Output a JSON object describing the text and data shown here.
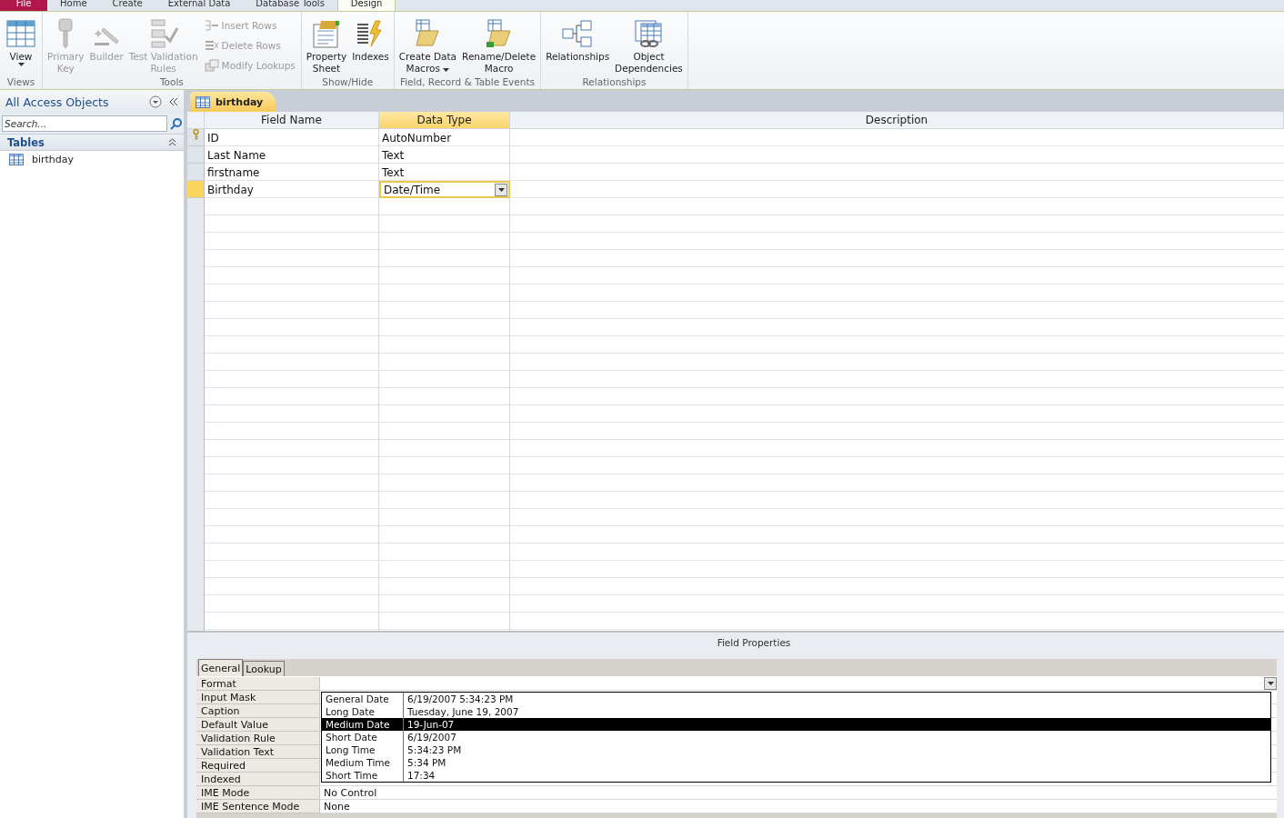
{
  "ribbon_tabs": [
    {
      "label": "File",
      "kind": "file",
      "selected": false
    },
    {
      "label": "Home",
      "kind": "tab",
      "selected": false
    },
    {
      "label": "Create",
      "kind": "tab",
      "selected": false
    },
    {
      "label": "External Data",
      "kind": "tab",
      "selected": false
    },
    {
      "label": "Database Tools",
      "kind": "tab",
      "selected": false
    },
    {
      "label": "Design",
      "kind": "tab",
      "selected": true
    }
  ],
  "ribbon_groups": [
    {
      "label": "Views",
      "items": [
        {
          "kind": "large",
          "lines": [
            "View"
          ],
          "dropdown": true,
          "disabled": false
        }
      ]
    },
    {
      "label": "Tools",
      "items": [
        {
          "kind": "large",
          "lines": [
            "Primary",
            "Key"
          ],
          "dropdown": false,
          "disabled": true
        },
        {
          "kind": "large",
          "lines": [
            "Builder"
          ],
          "dropdown": false,
          "disabled": true
        },
        {
          "kind": "large",
          "lines": [
            "Test Validation",
            "Rules"
          ],
          "dropdown": false,
          "disabled": true
        },
        {
          "kind": "stack",
          "buttons": [
            {
              "label": "Insert Rows",
              "disabled": true
            },
            {
              "label": "Delete Rows",
              "disabled": true
            },
            {
              "label": "Modify Lookups",
              "disabled": true
            }
          ]
        }
      ]
    },
    {
      "label": "Show/Hide",
      "items": [
        {
          "kind": "large",
          "lines": [
            "Property",
            "Sheet"
          ],
          "dropdown": false,
          "disabled": false
        },
        {
          "kind": "large",
          "lines": [
            "Indexes"
          ],
          "dropdown": false,
          "disabled": false
        }
      ]
    },
    {
      "label": "Field, Record & Table Events",
      "items": [
        {
          "kind": "large",
          "lines": [
            "Create Data",
            "Macros"
          ],
          "dropdown": true,
          "disabled": false
        },
        {
          "kind": "large",
          "lines": [
            "Rename/Delete",
            "Macro"
          ],
          "dropdown": false,
          "disabled": false
        }
      ]
    },
    {
      "label": "Relationships",
      "items": [
        {
          "kind": "large",
          "lines": [
            "Relationships"
          ],
          "dropdown": false,
          "disabled": false
        },
        {
          "kind": "large",
          "lines": [
            "Object",
            "Dependencies"
          ],
          "dropdown": false,
          "disabled": false
        }
      ]
    }
  ],
  "navigation_pane": {
    "title": "All Access Objects",
    "search": {
      "placeholder": "Search..."
    },
    "section": "Tables",
    "items": [
      {
        "label": "birthday"
      }
    ]
  },
  "document_tab": {
    "label": "birthday"
  },
  "design_grid": {
    "columns": [
      "Field Name",
      "Data Type",
      "Description"
    ],
    "rows": [
      {
        "field_name": "ID",
        "data_type": "AutoNumber",
        "primary_key": true,
        "selected": false
      },
      {
        "field_name": "Last Name",
        "data_type": "Text",
        "primary_key": false,
        "selected": false
      },
      {
        "field_name": "firstname",
        "data_type": "Text",
        "primary_key": false,
        "selected": false
      },
      {
        "field_name": "Birthday",
        "data_type": "Date/Time",
        "primary_key": false,
        "selected": true
      }
    ]
  },
  "field_properties": {
    "title": "Field Properties",
    "tabs": [
      {
        "label": "General",
        "selected": true
      },
      {
        "label": "Lookup",
        "selected": false
      }
    ],
    "properties": [
      {
        "label": "Format"
      },
      {
        "label": "Input Mask"
      },
      {
        "label": "Caption"
      },
      {
        "label": "Default Value"
      },
      {
        "label": "Validation Rule"
      },
      {
        "label": "Validation Text"
      },
      {
        "label": "Required"
      },
      {
        "label": "Indexed"
      },
      {
        "label": "IME Mode",
        "value": "No Control"
      },
      {
        "label": "IME Sentence Mode",
        "value": "None"
      }
    ],
    "format_options": [
      {
        "name": "General Date",
        "example": "6/19/2007 5:34:23 PM",
        "selected": false
      },
      {
        "name": "Long Date",
        "example": "Tuesday, June 19, 2007",
        "selected": false
      },
      {
        "name": "Medium Date",
        "example": "19-Jun-07",
        "selected": true
      },
      {
        "name": "Short Date",
        "example": "6/19/2007",
        "selected": false
      },
      {
        "name": "Long Time",
        "example": "5:34:23 PM",
        "selected": false
      },
      {
        "name": "Medium Time",
        "example": "5:34 PM",
        "selected": false
      },
      {
        "name": "Short Time",
        "example": "17:34",
        "selected": false
      }
    ]
  }
}
